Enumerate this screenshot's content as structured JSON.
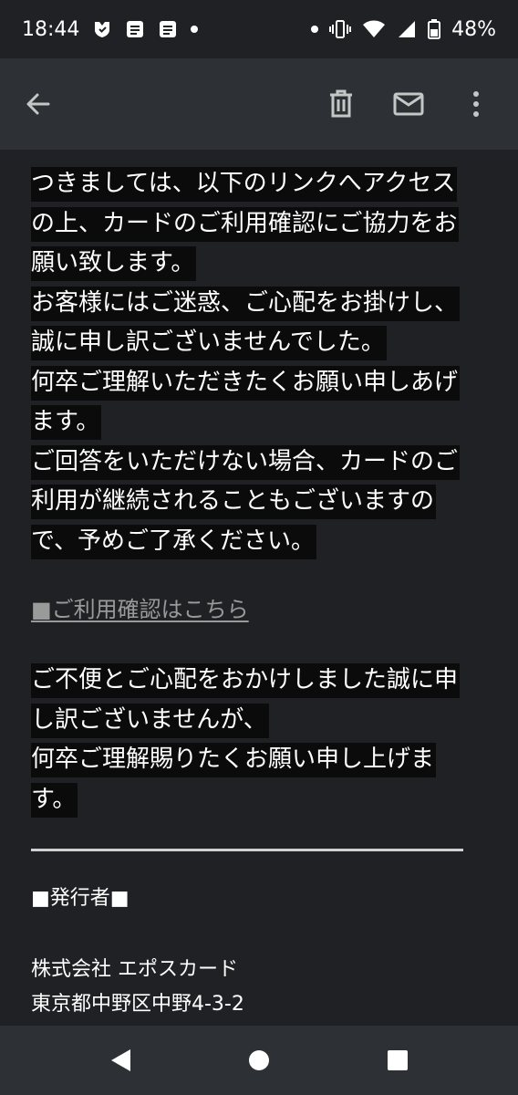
{
  "status_bar": {
    "time": "18:44",
    "battery": "48%",
    "left_icons": [
      "shield-icon",
      "notes-icon",
      "notes-icon",
      "dot-icon"
    ],
    "right_icons": [
      "dot-icon",
      "vibrate-icon",
      "wifi-icon",
      "signal-icon",
      "battery-icon"
    ]
  },
  "app_bar": {
    "icons": [
      "back-arrow-icon",
      "trash-icon",
      "mail-icon",
      "more-vert-icon"
    ]
  },
  "email": {
    "para1": [
      "つきましては、以下のリンクへアクセス",
      "の上、カードのご利用確認にご協力をお",
      "願い致します。",
      "お客様にはご迷惑、ご心配をお掛けし、",
      "誠に申し訳ございませんでした。",
      "何卒ご理解いただきたくお願い申しあげ",
      "ます。",
      "ご回答をいただけない場合、カードのご",
      "利用が継続されることもございますの",
      "で、予めご了承ください。"
    ],
    "link": "■ご利用確認はこちら",
    "para2": [
      "ご不便とご心配をおかけしました誠に申",
      "し訳ございませんが、",
      "何卒ご理解賜りたくお願い申し上げま",
      "す。"
    ],
    "issuer_label": "■発行者■",
    "company": "株式会社 エポスカード",
    "address": "東京都中野区中野4-3-2"
  },
  "nav_bar": {
    "icons": [
      "back-triangle-icon",
      "home-circle-icon",
      "recents-square-icon"
    ]
  },
  "colors": {
    "background": "#202124",
    "appbar": "#2d3034",
    "highlight": "#0b0b0b",
    "link": "#9a9a9a"
  }
}
